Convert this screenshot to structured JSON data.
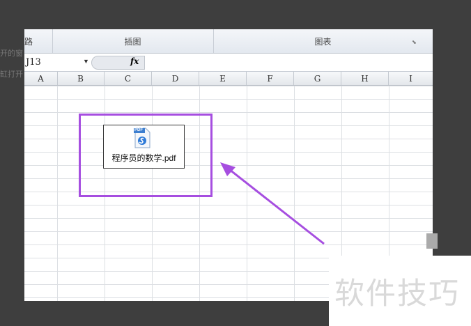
{
  "ribbon": {
    "groups": [
      "路",
      "插图",
      "图表"
    ]
  },
  "formula_bar": {
    "name_box": "J13",
    "fx": "fx"
  },
  "columns": [
    "A",
    "B",
    "C",
    "D",
    "E",
    "F",
    "G",
    "H",
    "I"
  ],
  "embedded_object": {
    "badge": "PDF",
    "filename": "程序员的数学.pdf"
  },
  "watermark": "软件技巧",
  "colors": {
    "highlight": "#a64ee0"
  }
}
